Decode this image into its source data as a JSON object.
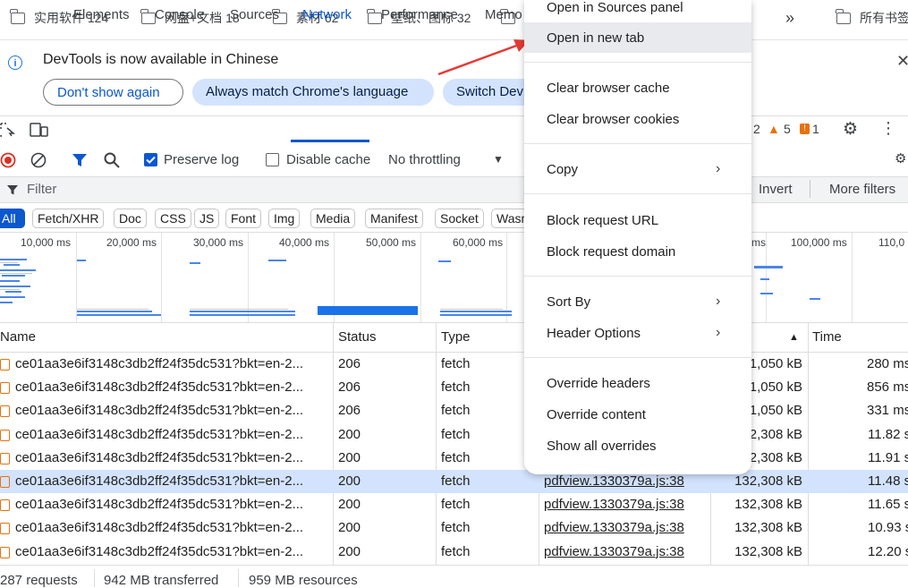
{
  "bookmarks": [
    {
      "label": "实用软件 124"
    },
    {
      "label": "网盘+文档 18"
    },
    {
      "label": "素材 62"
    },
    {
      "label": "壁纸、图标 32"
    },
    {
      "label": ""
    },
    {
      "label": "»"
    },
    {
      "label": "所有书签"
    }
  ],
  "infobar": {
    "message": "DevTools is now available in Chinese",
    "btn_dont_show": "Don't show again",
    "btn_always_match": "Always match Chrome's language",
    "btn_switch": "Switch Dev"
  },
  "tabs": [
    "Elements",
    "Console",
    "Sources",
    "Network",
    "Performance",
    "Memo"
  ],
  "badges": {
    "warnings": "2",
    "warning_count": "5",
    "errors": "1"
  },
  "toolbar": {
    "preserve_log": "Preserve log",
    "disable_cache": "Disable cache",
    "throttling": "No throttling"
  },
  "filter": {
    "placeholder": "Filter",
    "invert": "Invert",
    "more_filters": "More filters"
  },
  "type_chips": [
    "All",
    "Fetch/XHR",
    "Doc",
    "CSS",
    "JS",
    "Font",
    "Img",
    "Media",
    "Manifest",
    "Socket",
    "Wasm"
  ],
  "timeline_ticks": [
    "10,000 ms",
    "20,000 ms",
    "30,000 ms",
    "40,000 ms",
    "50,000 ms",
    "60,000 ms",
    "ms",
    "100,000 ms",
    "110,0"
  ],
  "columns": {
    "name": "Name",
    "status": "Status",
    "type": "Type",
    "time": "Time"
  },
  "rows": [
    {
      "name": "ce01aa3e6if3148c3db2ff24f35dc531?bkt=en-2...",
      "status": "206",
      "type": "fetch",
      "initiator": "",
      "size": "1,050 kB",
      "time": "280 ms"
    },
    {
      "name": "ce01aa3e6if3148c3db2ff24f35dc531?bkt=en-2...",
      "status": "206",
      "type": "fetch",
      "initiator": "",
      "size": "1,050 kB",
      "time": "856 ms"
    },
    {
      "name": "ce01aa3e6if3148c3db2ff24f35dc531?bkt=en-2...",
      "status": "206",
      "type": "fetch",
      "initiator": "",
      "size": "1,050 kB",
      "time": "331 ms"
    },
    {
      "name": "ce01aa3e6if3148c3db2ff24f35dc531?bkt=en-2...",
      "status": "200",
      "type": "fetch",
      "initiator": "",
      "size": "2,308 kB",
      "time": "11.82 s"
    },
    {
      "name": "ce01aa3e6if3148c3db2ff24f35dc531?bkt=en-2...",
      "status": "200",
      "type": "fetch",
      "initiator": "",
      "size": "2,308 kB",
      "time": "11.91 s"
    },
    {
      "name": "ce01aa3e6if3148c3db2ff24f35dc531?bkt=en-2...",
      "status": "200",
      "type": "fetch",
      "initiator": "pdfview.1330379a.js:38",
      "size": "132,308 kB",
      "time": "11.48 s"
    },
    {
      "name": "ce01aa3e6if3148c3db2ff24f35dc531?bkt=en-2...",
      "status": "200",
      "type": "fetch",
      "initiator": "pdfview.1330379a.js:38",
      "size": "132,308 kB",
      "time": "11.65 s"
    },
    {
      "name": "ce01aa3e6if3148c3db2ff24f35dc531?bkt=en-2...",
      "status": "200",
      "type": "fetch",
      "initiator": "pdfview.1330379a.js:38",
      "size": "132,308 kB",
      "time": "10.93 s"
    },
    {
      "name": "ce01aa3e6if3148c3db2ff24f35dc531?bkt=en-2...",
      "status": "200",
      "type": "fetch",
      "initiator": "pdfview.1330379a.js:38",
      "size": "132,308 kB",
      "time": "12.20 s"
    }
  ],
  "statusbar": {
    "requests": "287 requests",
    "transferred": "942 MB transferred",
    "resources": "959 MB resources"
  },
  "context_menu": {
    "open_sources": "Open in Sources panel",
    "open_new_tab": "Open in new tab",
    "clear_cache": "Clear browser cache",
    "clear_cookies": "Clear browser cookies",
    "copy": "Copy",
    "block_url": "Block request URL",
    "block_domain": "Block request domain",
    "sort_by": "Sort By",
    "header_options": "Header Options",
    "override_headers": "Override headers",
    "override_content": "Override content",
    "show_overrides": "Show all overrides"
  },
  "colors": {
    "accent": "#0b57d0",
    "selected_row": "#d3e3fd",
    "arrow": "#e53935",
    "warning": "#e8710a",
    "error": "#e8710a"
  }
}
